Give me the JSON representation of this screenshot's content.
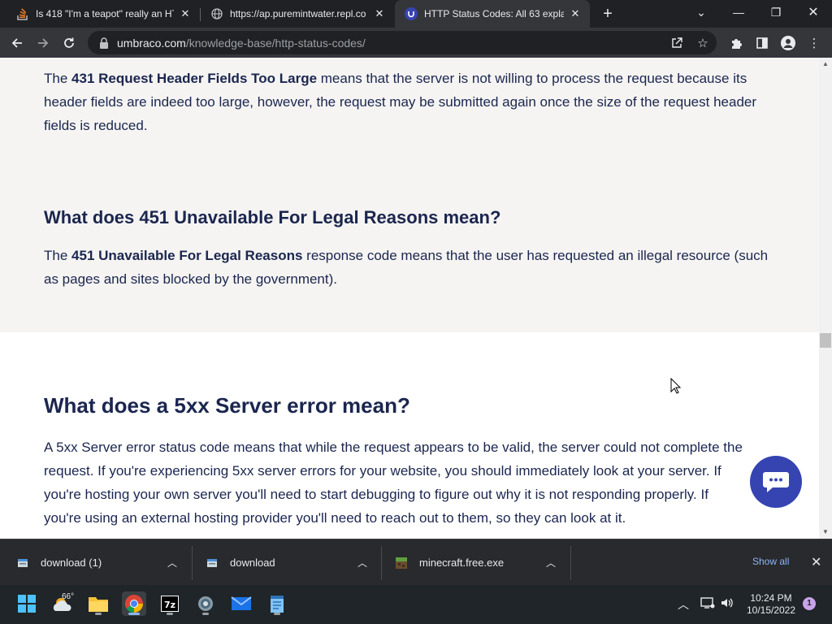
{
  "browser": {
    "tabs": [
      {
        "title": "Is 418 \"I'm a teapot\" really an HT",
        "favicon": "stackoverflow-icon"
      },
      {
        "title": "https://ap.puremintwater.repl.co",
        "favicon": "globe-icon"
      },
      {
        "title": "HTTP Status Codes: All 63 explain",
        "favicon": "umbraco-icon"
      }
    ],
    "url_host": "umbraco.com",
    "url_path": "/knowledge-base/http-status-codes/"
  },
  "content": {
    "p431_pre": "The ",
    "p431_bold": "431 Request Header Fields Too Large",
    "p431_line1": " means that the server is not willing to process the request because its",
    "p431_line2": "header fields are indeed too large, however, the request may be submitted again once the size of the request header",
    "p431_line3": "fields is reduced.",
    "h451": "What does 451 Unavailable For Legal Reasons mean?",
    "p451_pre": "The ",
    "p451_bold": "451 Unavailable For Legal Reasons",
    "p451_line1": " response code means that the user has requested an illegal resource (such",
    "p451_line2": "as pages and sites blocked by the government).",
    "h5xx": "What does a 5xx Server error mean?",
    "p5xx_line1": "A 5xx Server error status code means that while the request appears to be valid, the server could not complete the",
    "p5xx_line2": "request. If you're experiencing 5xx server errors for your website, you should immediately look at your server. If",
    "p5xx_line3": "you're hosting your own server you'll need to start debugging to figure out why it is not responding properly. If",
    "p5xx_line4": "you're using an external hosting provider you'll need to reach out to them, so they can look at it."
  },
  "downloads": {
    "items": [
      {
        "name": "download (1)",
        "icon": "file-icon"
      },
      {
        "name": "download",
        "icon": "file-icon"
      },
      {
        "name": "minecraft.free.exe",
        "icon": "minecraft-icon"
      }
    ],
    "show_all": "Show all"
  },
  "taskbar": {
    "weather_temp": "66°",
    "time": "10:24 PM",
    "date": "10/15/2022",
    "notifications": "1"
  },
  "colors": {
    "accent": "#3544b1",
    "heading": "#1b264f",
    "section_bg": "#f5f4f2"
  }
}
